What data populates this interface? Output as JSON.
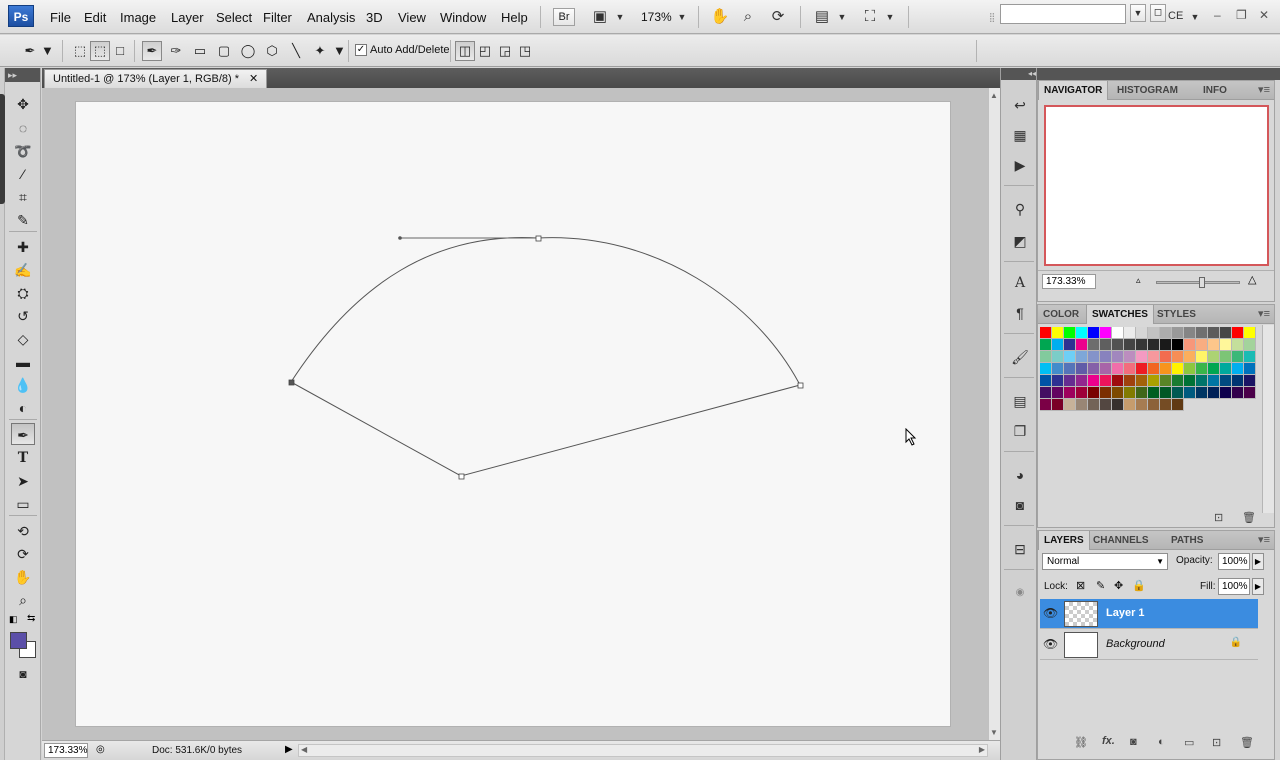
{
  "app": {
    "logo": "Ps"
  },
  "menubar": {
    "items": [
      "File",
      "Edit",
      "Image",
      "Layer",
      "Select",
      "Filter",
      "Analysis",
      "3D",
      "View",
      "Window",
      "Help"
    ],
    "bridge_label": "Br",
    "zoom_display": "173%",
    "workspace_label": "CE",
    "icons": [
      "screen-mode-icon",
      "hand-icon",
      "zoom-icon",
      "rotate-view-icon",
      "arrange-documents-icon"
    ]
  },
  "options_bar": {
    "auto_add_delete_label": "Auto Add/Delete",
    "auto_add_delete_checked": true
  },
  "document": {
    "tab_title": "Untitled-1 @ 173% (Layer 1, RGB/8) *",
    "close_glyph": "✕",
    "status_zoom": "173.33%",
    "doc_info": "Doc: 531.6K/0 bytes"
  },
  "colors": {
    "foreground": "#5b4fa8",
    "background": "#ffffff",
    "selection": "#3b8ce0",
    "nav_proxy": "#d4575a"
  },
  "navigator": {
    "tabs": [
      "NAVIGATOR",
      "HISTOGRAM",
      "INFO"
    ],
    "zoom": "173.33%",
    "slider_fraction": 0.55
  },
  "color_panel": {
    "tabs": [
      "COLOR",
      "SWATCHES",
      "STYLES"
    ],
    "swatches": [
      "#ff0000",
      "#ffff00",
      "#00ff00",
      "#00ffff",
      "#0000ff",
      "#ff00ff",
      "#ffffff",
      "#ebebeb",
      "#d6d6d6",
      "#c2c2c2",
      "#adadad",
      "#999999",
      "#858585",
      "#707070",
      "#5c5c5c",
      "#474747",
      "#ff0000",
      "#ffff00",
      "#00a651",
      "#00aeef",
      "#2e3192",
      "#ec008c",
      "#6d6d6d",
      "#5f5f5f",
      "#525252",
      "#444444",
      "#363636",
      "#292929",
      "#1a1a1a",
      "#000000",
      "#f7977a",
      "#f9ad81",
      "#fdc68a",
      "#fff79a",
      "#c4df9b",
      "#a3d39c",
      "#82ca9d",
      "#7bcdc8",
      "#6ecff6",
      "#7ea7d8",
      "#8493ca",
      "#8882be",
      "#a187be",
      "#bc8dbf",
      "#f49ac2",
      "#f6989d",
      "#f26c4f",
      "#f68e56",
      "#fbaf5d",
      "#fff568",
      "#acd373",
      "#7cc576",
      "#3bb878",
      "#1abbb4",
      "#00bff3",
      "#438ccb",
      "#5574b9",
      "#605ca8",
      "#8560a8",
      "#a864a8",
      "#f06eaa",
      "#f26d7d",
      "#ed1c24",
      "#f26522",
      "#f7941d",
      "#fff200",
      "#8dc73f",
      "#39b54a",
      "#00a651",
      "#00a99d",
      "#00aeef",
      "#0072bc",
      "#0054a6",
      "#2e3192",
      "#662d91",
      "#92278f",
      "#ec008c",
      "#ed145b",
      "#9e0b0f",
      "#a0410d",
      "#a36209",
      "#aba000",
      "#598527",
      "#197b30",
      "#007236",
      "#00746b",
      "#0076a3",
      "#004a80",
      "#003471",
      "#1b1464",
      "#440e62",
      "#630460",
      "#9e005d",
      "#9e0039",
      "#790000",
      "#7b2e00",
      "#7d4900",
      "#827b00",
      "#406618",
      "#005e20",
      "#005826",
      "#005952",
      "#005b7f",
      "#003663",
      "#002157",
      "#0d004c",
      "#32004b",
      "#4b0049",
      "#7b0046",
      "#7a0026",
      "#c7b299",
      "#998675",
      "#736357",
      "#534741",
      "#37302d",
      "#c69c6d",
      "#a67c52",
      "#8c6239",
      "#754c24",
      "#603913"
    ]
  },
  "layers_panel": {
    "tabs": [
      "LAYERS",
      "CHANNELS",
      "PATHS"
    ],
    "blend_mode": "Normal",
    "opacity_label": "Opacity:",
    "opacity": "100%",
    "lock_label": "Lock:",
    "fill_label": "Fill:",
    "fill": "100%",
    "layers": [
      {
        "name": "Layer 1",
        "selected": true,
        "transparent": true
      },
      {
        "name": "Background",
        "selected": false,
        "locked": true
      }
    ],
    "footer_icons": [
      "link-layers-icon",
      "fx-icon",
      "layer-mask-icon",
      "adjustment-layer-icon",
      "new-group-icon",
      "new-layer-icon",
      "delete-layer-icon"
    ],
    "fx_glyph": "fx."
  }
}
